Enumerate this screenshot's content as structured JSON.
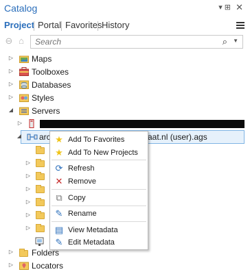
{
  "window": {
    "title": "Catalog",
    "pin_glyph": "▾ ⊞",
    "close_glyph": "✕"
  },
  "tabs": [
    {
      "label": "Project"
    },
    {
      "label": "Portal"
    },
    {
      "label": "Favorites"
    },
    {
      "label": "History"
    }
  ],
  "nav": {
    "back_glyph": "⊖",
    "home_glyph": "⌂"
  },
  "search": {
    "placeholder": "Search",
    "value": "",
    "icon": "⌕",
    "dropdown": "▼"
  },
  "tree": {
    "items": [
      {
        "label": "Maps",
        "icon": "maps-icon"
      },
      {
        "label": "Toolboxes",
        "icon": "toolboxes-icon"
      },
      {
        "label": "Databases",
        "icon": "databases-icon"
      },
      {
        "label": "Styles",
        "icon": "styles-icon"
      },
      {
        "label": "Servers",
        "icon": "servers-icon",
        "expanded": true
      },
      {
        "label": "",
        "icon": "server-connection-icon",
        "redacted": true
      },
      {
        "label_prefix": "arc",
        "label_suffix": "aat.nl (user).ags",
        "icon": "server-connection-icon",
        "selected": true
      },
      {
        "label": "Folders",
        "icon": "folder-icon"
      },
      {
        "label": "Locators",
        "icon": "locators-icon"
      }
    ]
  },
  "context_menu": {
    "items": [
      {
        "label": "Add To Favorites",
        "icon": "★",
        "color": "#f0c419"
      },
      {
        "label": "Add To New Projects",
        "icon": "★",
        "color": "#f0c419"
      },
      {
        "label": "Refresh",
        "icon": "⟳",
        "color": "#2a6ebb"
      },
      {
        "label": "Remove",
        "icon": "✕",
        "color": "#c62828"
      },
      {
        "label": "Copy",
        "icon": "⧉",
        "color": "#777777"
      },
      {
        "label": "Rename",
        "icon": "✎",
        "color": "#2a6ebb"
      },
      {
        "label": "View Metadata",
        "icon": "▤",
        "color": "#2a6ebb"
      },
      {
        "label": "Edit Metadata",
        "icon": "✎",
        "color": "#2a6ebb"
      }
    ]
  },
  "colors": {
    "accent": "#2a6ebb",
    "selection": "#e6f1fb",
    "folder": "#f3c95b"
  }
}
